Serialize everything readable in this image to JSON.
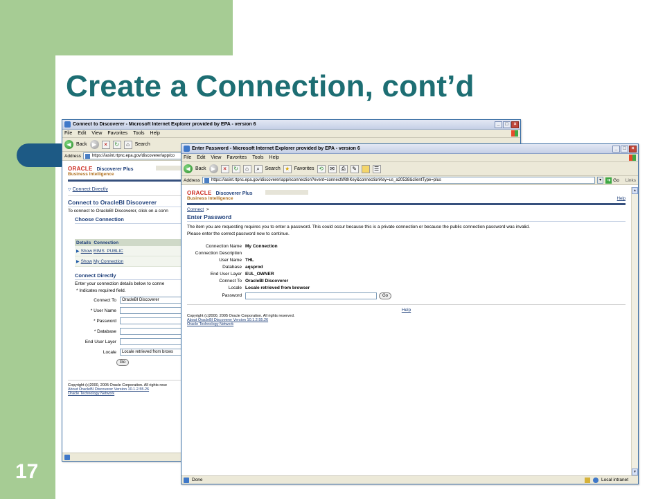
{
  "slide": {
    "title": "Create a Connection, cont’d",
    "number": "17",
    "colors": {
      "green": "#a6cc94",
      "title": "#1d6e73",
      "accent": "#1d5a85"
    }
  },
  "back_window": {
    "title": "Connect to Discoverer - Microsoft Internet Explorer provided by EPA - version 6",
    "menu": [
      "File",
      "Edit",
      "View",
      "Favorites",
      "Tools",
      "Help"
    ],
    "toolbar": {
      "back_label": "Back",
      "search_label": "Search"
    },
    "address": "https://iasint.rtpnc.epa.gov/discoverer/app/co",
    "page": {
      "oracle_logo": "ORACLE",
      "product": "Discoverer Plus",
      "bi": "Business Intelligence",
      "connect_directly_link": "Connect Directly",
      "heading": "Connect to OracleBI Discoverer",
      "intro": "To connect to OracleBI Discoverer, click on a conn",
      "choose_connection": "Choose Connection",
      "table_headers": [
        "Details",
        "Connection"
      ],
      "rows": [
        {
          "show": "Show",
          "connection": "EIMS_PUBLIC"
        },
        {
          "show": "Show",
          "connection": "My Connection"
        }
      ],
      "connect_directly_heading": "Connect Directly",
      "connect_directly_intro": "Enter your connection details below to conne",
      "required_note": "Indicates required field.",
      "fields": [
        {
          "label": "Connect To",
          "value": "OracleBI Discoverer",
          "required": false
        },
        {
          "label": "User Name",
          "value": "",
          "required": true
        },
        {
          "label": "Password",
          "value": "",
          "required": true
        },
        {
          "label": "Database",
          "value": "",
          "required": true
        },
        {
          "label": "End User Layer",
          "value": "",
          "required": false
        },
        {
          "label": "Locale",
          "value": "Locale retrieved from brows",
          "required": false
        }
      ],
      "go_label": "Go",
      "copyright": "Copyright (c)2000, 2005 Oracle Corporation. All rights rese",
      "about_link": "About OracleBI Discoverer Version 10.1.2.55.26",
      "otn_link": "Oracle Technology Network"
    }
  },
  "front_window": {
    "title": "Enter Password - Microsoft Internet Explorer provided by EPA - version 6",
    "menu": [
      "File",
      "Edit",
      "View",
      "Favorites",
      "Tools",
      "Help"
    ],
    "toolbar": {
      "back_label": "Back",
      "search_label": "Search",
      "favorites_label": "Favorites"
    },
    "address_label": "Address",
    "address": "https://iasint.rtpnc.epa.gov/discoverer/app/econnection?event=connectWithKey&connectionKey=us_a20538&clientType=plus",
    "go_label": "Go",
    "links_label": "Links",
    "status_text": "Done",
    "zone_text": "Local intranet",
    "page": {
      "oracle_logo": "ORACLE",
      "product": "Discoverer Plus",
      "bi": "Business Intelligence",
      "help_top": "Help",
      "breadcrumb": "Connect",
      "breadcrumb_sep": ">",
      "heading": "Enter Password",
      "message": "The item you are requesting requires you to enter a password. This could occur because this is a private connection or because the public connection password was invalid. Please enter the correct password now to continue.",
      "details": [
        {
          "label": "Connection Name",
          "value": "My Connection"
        },
        {
          "label": "Connection Description",
          "value": ""
        },
        {
          "label": "User Name",
          "value": "THL"
        },
        {
          "label": "Database",
          "value": "aqsprod"
        },
        {
          "label": "End User Layer",
          "value": "EUL_OWNER"
        },
        {
          "label": "Connect To",
          "value": "OracleBI Discoverer"
        },
        {
          "label": "Locale",
          "value": "Locale retrieved from browser"
        }
      ],
      "password_label": "Password",
      "go_label": "Go",
      "help_bottom": "Help",
      "copyright": "Copyright (c)2000, 2005 Oracle Corporation. All rights reserved.",
      "about_link": "About OracleBI Discoverer Version 10.1.2.55.26",
      "otn_link": "Oracle Technology Network"
    }
  }
}
